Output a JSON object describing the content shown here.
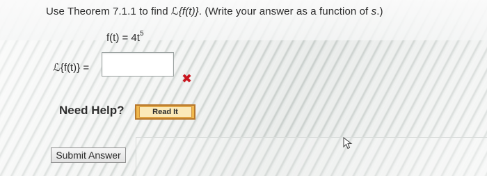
{
  "question": {
    "prefix": "Use Theorem 7.1.1 to find ",
    "laplace_expr": "ℒ{f(t)}",
    "suffix": ". (Write your answer as a function of ",
    "var": "s",
    "end": ".)"
  },
  "formula": {
    "lhs": "f(t) = 4t",
    "exponent": "5"
  },
  "answer": {
    "label": "ℒ{f(t)} =",
    "value": "",
    "status_mark": "✖"
  },
  "help": {
    "label": "Need Help?",
    "read_button": "Read It"
  },
  "submit": {
    "label": "Submit Answer"
  }
}
